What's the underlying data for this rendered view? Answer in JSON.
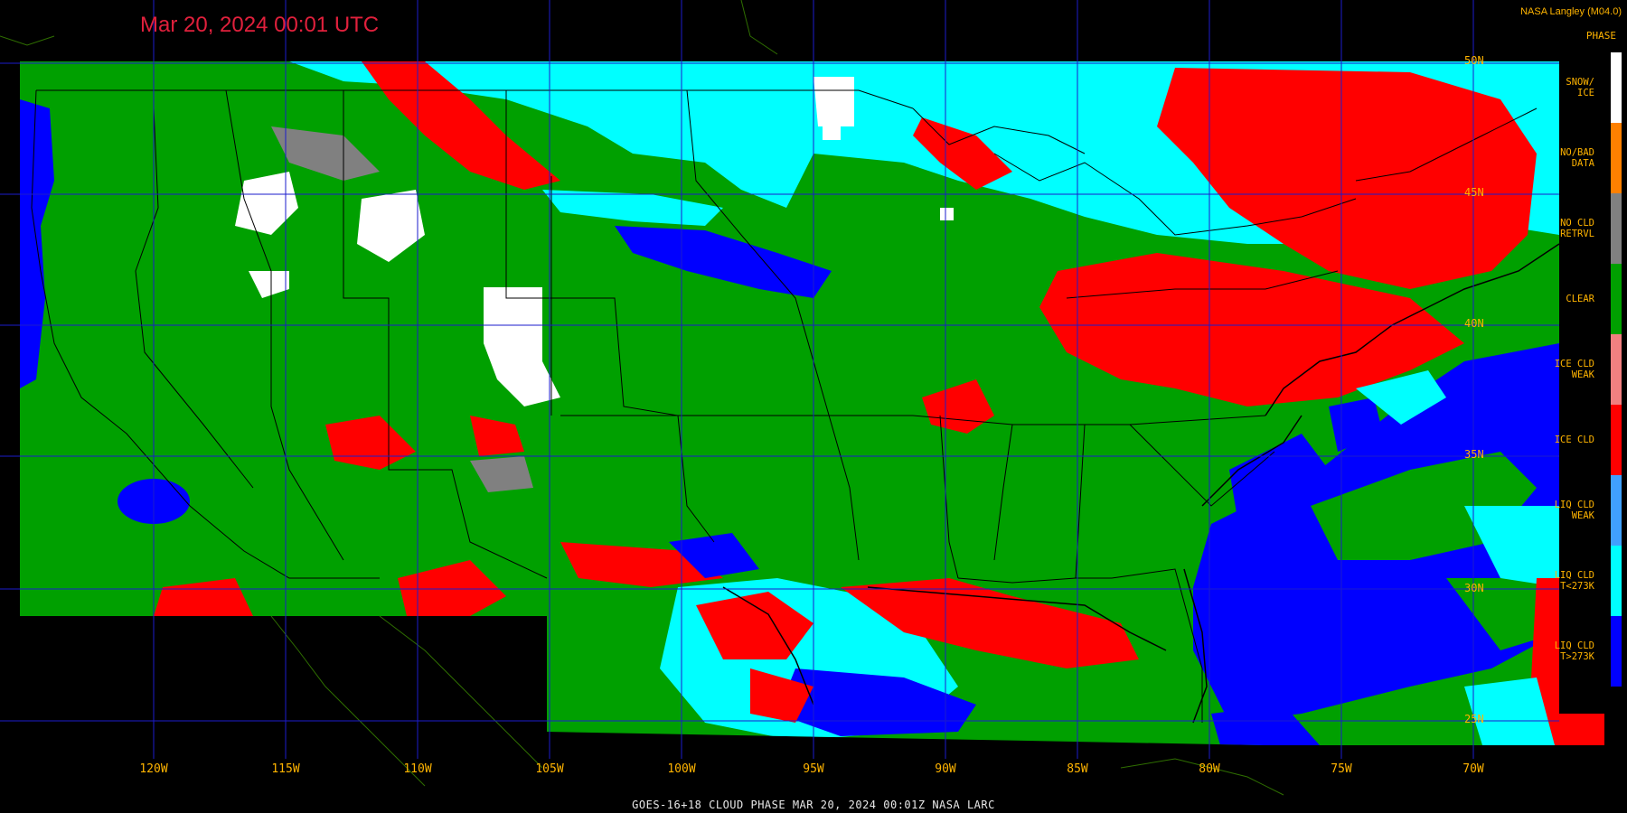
{
  "timestamp": "Mar 20, 2024 00:01 UTC",
  "provider": "NASA Langley (M04.0)",
  "legend": {
    "title": "PHASE",
    "items": [
      {
        "label": "SNOW/\nICE",
        "color": "#ffffff"
      },
      {
        "label": "NO/BAD\nDATA",
        "color": "#ff8000"
      },
      {
        "label": "NO CLD\nRETRVL",
        "color": "#808080"
      },
      {
        "label": "CLEAR",
        "color": "#00a000"
      },
      {
        "label": "ICE CLD\nWEAK",
        "color": "#f08080"
      },
      {
        "label": "ICE CLD",
        "color": "#ff0000"
      },
      {
        "label": "LIQ CLD\nWEAK",
        "color": "#40a0ff"
      },
      {
        "label": "LIQ CLD\nT<273K",
        "color": "#00ffff"
      },
      {
        "label": "LIQ CLD\nT>273K",
        "color": "#0000ff"
      }
    ]
  },
  "longitudes": [
    "120W",
    "115W",
    "110W",
    "105W",
    "100W",
    "95W",
    "90W",
    "85W",
    "80W",
    "75W",
    "70W"
  ],
  "latitudes": [
    "50N",
    "45N",
    "40N",
    "35N",
    "30N",
    "25N"
  ],
  "footer": "GOES-16+18  CLOUD PHASE   MAR 20, 2024 00:01Z   NASA LARC"
}
